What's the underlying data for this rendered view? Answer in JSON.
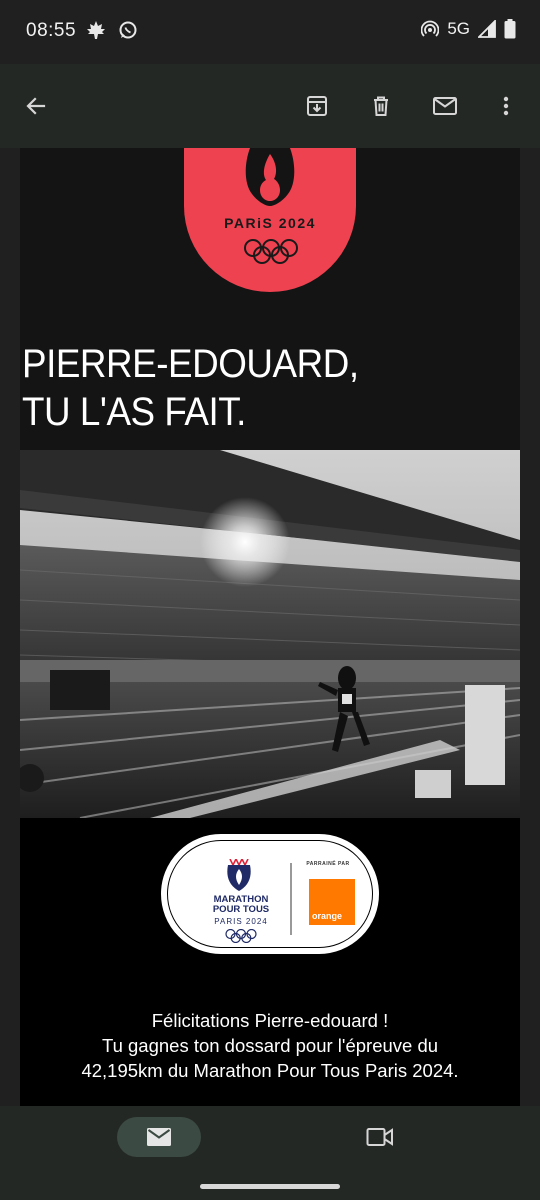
{
  "status_bar": {
    "time": "08:55",
    "network": "5G",
    "icons": [
      "maple-leaf-icon",
      "whatsapp-icon",
      "hotspot-icon",
      "signal-icon",
      "battery-icon"
    ]
  },
  "app_bar": {
    "icons": [
      "back-arrow-icon",
      "archive-icon",
      "delete-icon",
      "mark-unread-icon",
      "more-vert-icon"
    ]
  },
  "email": {
    "logo_text": "PARiS 2024",
    "headline_line1": "PIERRE-EDOUARD,",
    "headline_line2": "TU L'AS FAIT.",
    "badge": {
      "title_line1": "MARATHON",
      "title_line2": "POUR TOUS",
      "subtitle": "PARIS 2024",
      "sponsor_label": "PARRAINÉ PAR",
      "sponsor_name": "orange"
    },
    "message_line1": "Félicitations Pierre-edouard !",
    "message_line2": "Tu gagnes ton dossard pour l'épreuve du",
    "message_line3": "42,195km du Marathon Pour Tous Paris 2024."
  },
  "bottom_nav": {
    "items": [
      "mail-icon",
      "video-camera-icon"
    ]
  },
  "colors": {
    "logo_red": "#ee4251",
    "orange": "#ff7900",
    "navy": "#1f2a66"
  }
}
